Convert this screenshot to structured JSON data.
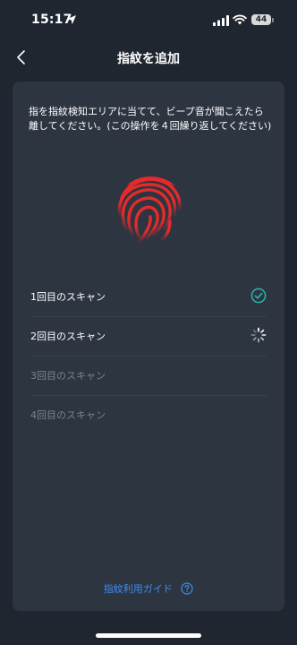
{
  "status_bar": {
    "time": "15:17",
    "battery": "44"
  },
  "nav": {
    "title": "指紋を追加"
  },
  "instruction": "指を指紋検知エリアに当てて、ビープ音が聞こえたら離してください。(この操作を４回繰り返してください)",
  "scans": [
    {
      "label": "1回目のスキャン",
      "status": "complete"
    },
    {
      "label": "2回目のスキャン",
      "status": "in-progress"
    },
    {
      "label": "3回目のスキャン",
      "status": "pending"
    },
    {
      "label": "4回目のスキャン",
      "status": "pending"
    }
  ],
  "guide": {
    "label": "指紋利用ガイド"
  },
  "icons": {
    "location": "location-arrow-icon",
    "signal": "cellular-signal-icon",
    "wifi": "wifi-icon",
    "back": "chevron-left-icon",
    "fingerprint": "fingerprint-icon",
    "check": "check-circle-icon",
    "spinner": "spinner-icon",
    "help": "question-circle-icon"
  },
  "colors": {
    "background": "#1f2630",
    "card": "#2d3541",
    "fingerprint": "#e52a2a",
    "success": "#2ab7a9",
    "link": "#3d8ef0",
    "pending_text": "#7a828d"
  }
}
